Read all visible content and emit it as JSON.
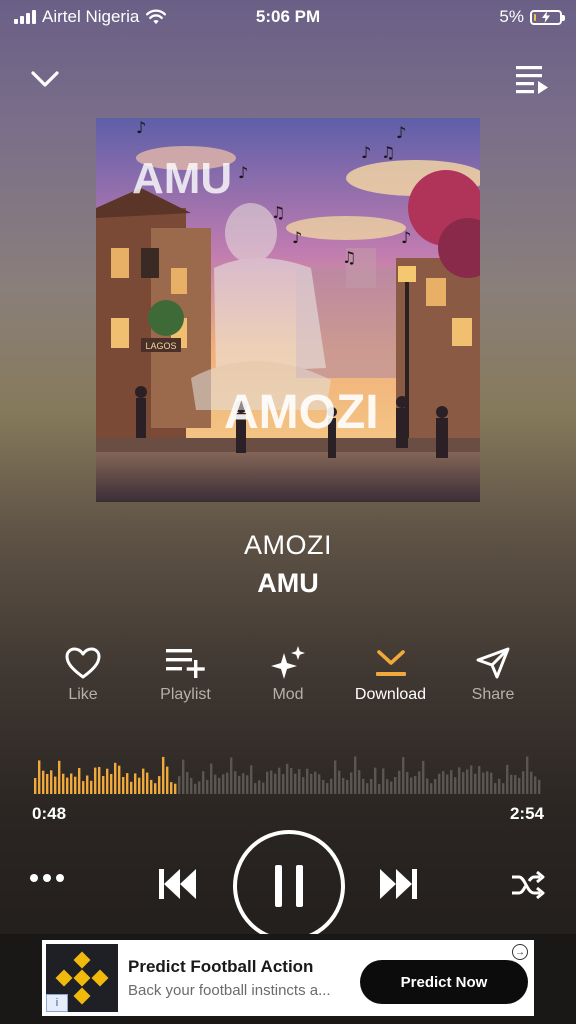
{
  "status_bar": {
    "carrier": "Airtel Nigeria",
    "time": "5:06 PM",
    "battery": "5%",
    "battery_level": 0.05,
    "battery_color": "#f5c142"
  },
  "header": {
    "collapse_icon": "chevron-down-icon",
    "queue_icon": "queue-list-icon"
  },
  "artwork": {
    "artist_text": "AMU",
    "title_text": "AMOZI",
    "sign_text": "LAGOS"
  },
  "track": {
    "title": "AMOZI",
    "artist": "AMU"
  },
  "actions": [
    {
      "label": "Like",
      "icon": "heart-icon",
      "active": false
    },
    {
      "label": "Playlist",
      "icon": "playlist-add-icon",
      "active": false
    },
    {
      "label": "Mod",
      "icon": "sparkle-icon",
      "active": false
    },
    {
      "label": "Download",
      "icon": "download-icon",
      "active": true
    },
    {
      "label": "Share",
      "icon": "share-icon",
      "active": false
    }
  ],
  "player": {
    "current_time": "0:48",
    "total_time": "2:54",
    "progress": 0.276,
    "played_color": "#f2a93b",
    "unplayed_color": "#5c5652",
    "accent_color": "#f2a93b"
  },
  "controls": {
    "more_icon": "more-dots-icon",
    "prev_icon": "skip-previous-icon",
    "play_state_icon": "pause-icon",
    "next_icon": "skip-next-icon",
    "shuffle_icon": "shuffle-icon"
  },
  "ad": {
    "title": "Predict Football Action",
    "description": "Back your football instincts a...",
    "cta": "Predict Now",
    "info_badge": "i",
    "logo_icon": "binance-logo-icon",
    "logo_color": "#f0b90b"
  }
}
